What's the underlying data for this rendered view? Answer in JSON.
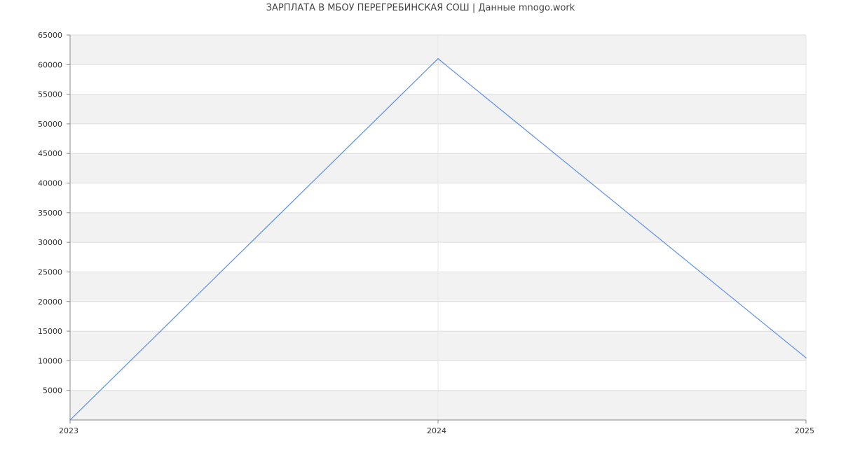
{
  "chart_data": {
    "type": "line",
    "title": "ЗАРПЛАТА В МБОУ ПЕРЕГРЕБИНСКАЯ СОШ | Данные mnogo.work",
    "xlabel": "",
    "ylabel": "",
    "x": [
      "2023",
      "2024",
      "2025"
    ],
    "series": [
      {
        "values": [
          0,
          61000,
          10500
        ],
        "color": "#5b8ff0"
      }
    ],
    "ylim": [
      0,
      65000
    ],
    "y_ticks": [
      5000,
      10000,
      15000,
      20000,
      25000,
      30000,
      35000,
      40000,
      45000,
      50000,
      55000,
      60000,
      65000
    ],
    "y_tick_labels": [
      "5000",
      "10000",
      "15000",
      "20000",
      "25000",
      "30000",
      "35000",
      "40000",
      "45000",
      "50000",
      "55000",
      "60000",
      "65000"
    ],
    "x_tick_labels": [
      "2023",
      "2024",
      "2025"
    ],
    "grid": true,
    "band_color": "#f2f2f2",
    "grid_color": "#dddddd",
    "axis_color": "#888888",
    "legend": "none"
  }
}
